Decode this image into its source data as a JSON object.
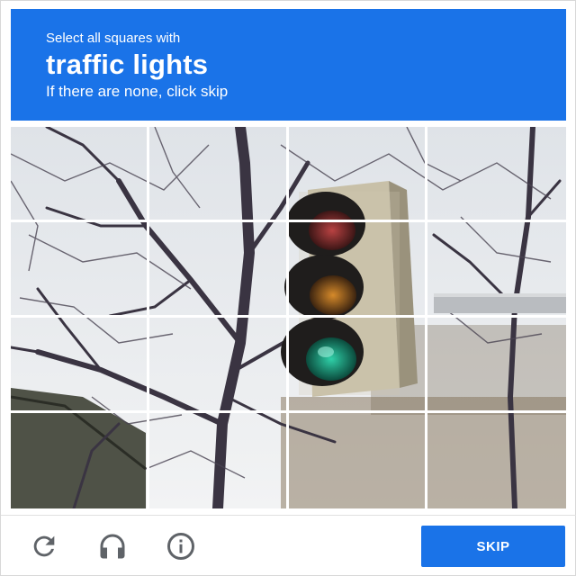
{
  "header": {
    "instruction": "Select all squares with",
    "target": "traffic lights",
    "hint": "If there are none, click skip"
  },
  "grid": {
    "rows": 4,
    "cols": 4,
    "image_subject": "traffic-light-with-bare-trees"
  },
  "footer": {
    "icons": [
      "reload-icon",
      "audio-headphones-icon",
      "info-icon"
    ],
    "skip_label": "SKIP"
  },
  "colors": {
    "accent": "#1a73e8",
    "text_on_accent": "#ffffff",
    "icon": "#5f6368"
  }
}
